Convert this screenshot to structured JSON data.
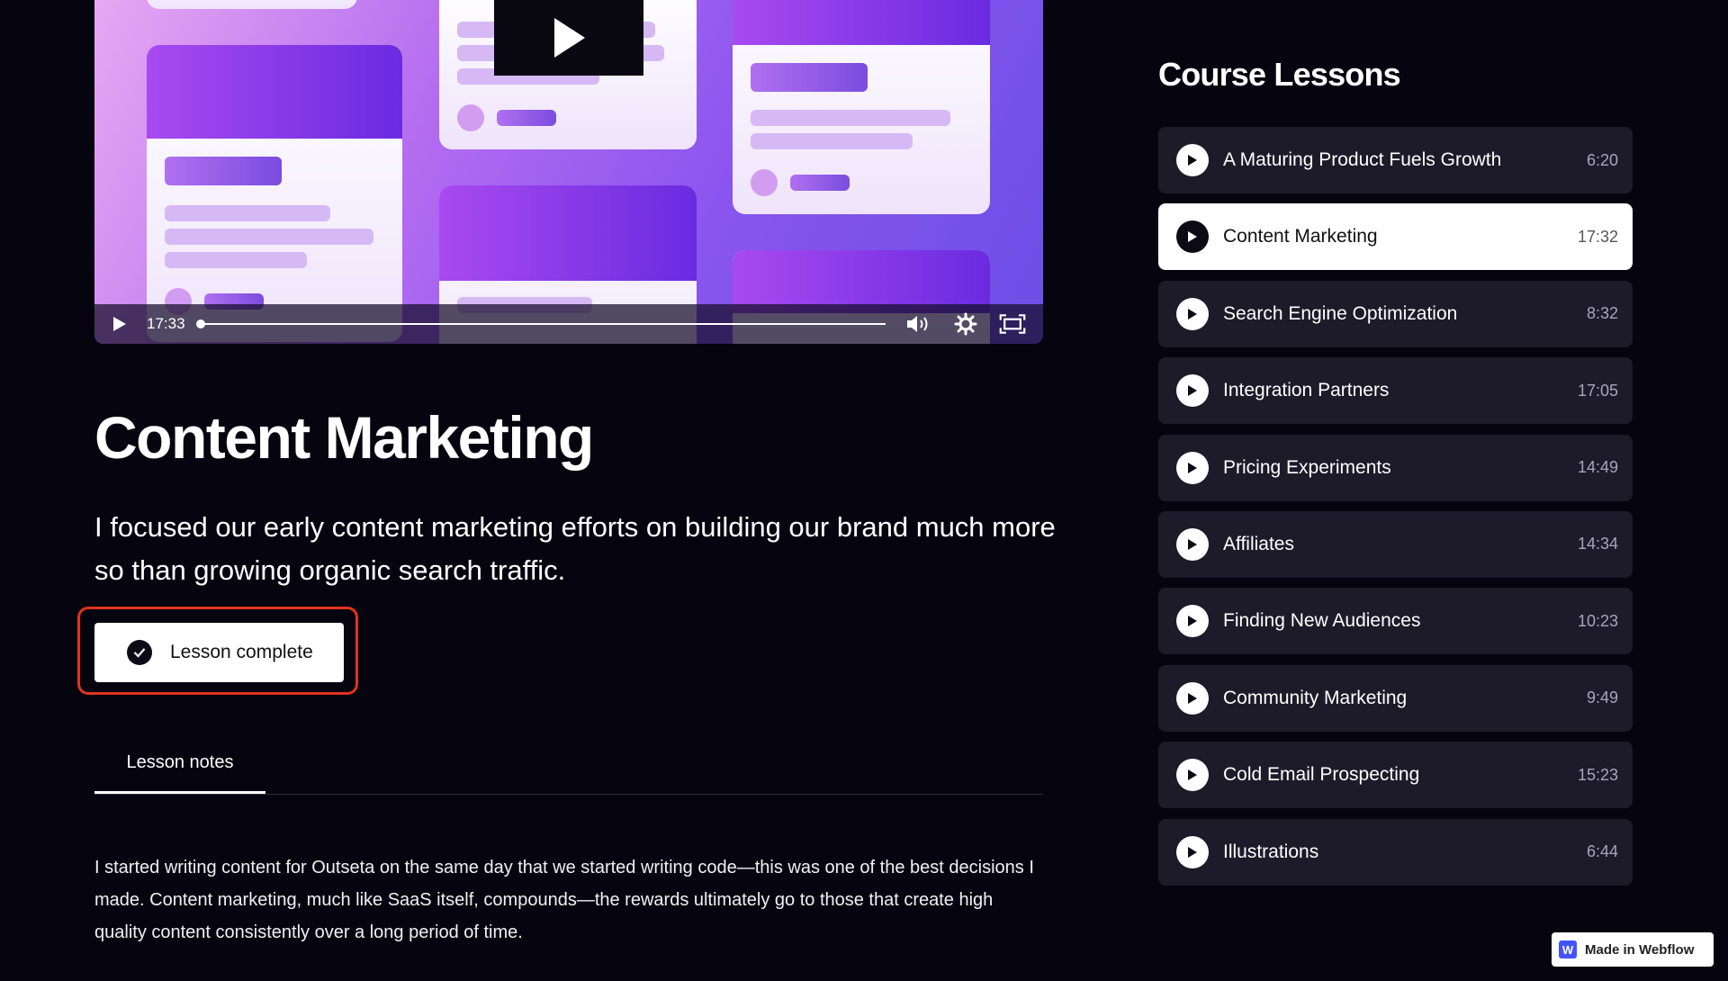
{
  "video": {
    "time": "17:33",
    "progress": 0.0
  },
  "lesson": {
    "title": "Content Marketing",
    "subtitle": "I focused our early content marketing efforts on building our brand much more so than growing organic search traffic.",
    "complete_label": "Lesson complete",
    "tab_label": "Lesson notes",
    "body": "I started writing content for Outseta on the same day that we started writing code—this was one of the best decisions I made. Content marketing, much like SaaS itself, compounds—the rewards ultimately go to those that create high quality content consistently over a long period of time."
  },
  "sidebar": {
    "title": "Course Lessons",
    "items": [
      {
        "label": "A Maturing Product Fuels Growth",
        "duration": "6:20"
      },
      {
        "label": "Content Marketing",
        "duration": "17:32",
        "active": true
      },
      {
        "label": "Search Engine Optimization",
        "duration": "8:32"
      },
      {
        "label": "Integration Partners",
        "duration": "17:05"
      },
      {
        "label": "Pricing Experiments",
        "duration": "14:49"
      },
      {
        "label": "Affiliates",
        "duration": "14:34"
      },
      {
        "label": "Finding New Audiences",
        "duration": "10:23"
      },
      {
        "label": "Community Marketing",
        "duration": "9:49"
      },
      {
        "label": "Cold Email Prospecting",
        "duration": "15:23"
      },
      {
        "label": "Illustrations",
        "duration": "6:44"
      }
    ]
  },
  "badge": {
    "label": "Made in Webflow",
    "logo_letter": "W"
  },
  "colors": {
    "background": "#06040f",
    "lesson_card": "#1d1b2a",
    "highlight": "#e0331f",
    "webflow_blue": "#4353ff"
  }
}
